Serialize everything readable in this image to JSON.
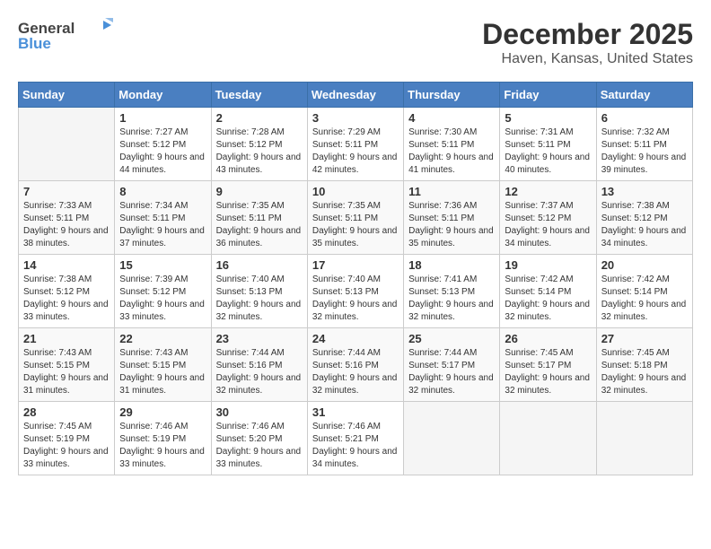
{
  "header": {
    "logo_general": "General",
    "logo_blue": "Blue",
    "title": "December 2025",
    "subtitle": "Haven, Kansas, United States"
  },
  "days_of_week": [
    "Sunday",
    "Monday",
    "Tuesday",
    "Wednesday",
    "Thursday",
    "Friday",
    "Saturday"
  ],
  "weeks": [
    [
      {
        "day": "",
        "sunrise": "",
        "sunset": "",
        "daylight": ""
      },
      {
        "day": "1",
        "sunrise": "Sunrise: 7:27 AM",
        "sunset": "Sunset: 5:12 PM",
        "daylight": "Daylight: 9 hours and 44 minutes."
      },
      {
        "day": "2",
        "sunrise": "Sunrise: 7:28 AM",
        "sunset": "Sunset: 5:12 PM",
        "daylight": "Daylight: 9 hours and 43 minutes."
      },
      {
        "day": "3",
        "sunrise": "Sunrise: 7:29 AM",
        "sunset": "Sunset: 5:11 PM",
        "daylight": "Daylight: 9 hours and 42 minutes."
      },
      {
        "day": "4",
        "sunrise": "Sunrise: 7:30 AM",
        "sunset": "Sunset: 5:11 PM",
        "daylight": "Daylight: 9 hours and 41 minutes."
      },
      {
        "day": "5",
        "sunrise": "Sunrise: 7:31 AM",
        "sunset": "Sunset: 5:11 PM",
        "daylight": "Daylight: 9 hours and 40 minutes."
      },
      {
        "day": "6",
        "sunrise": "Sunrise: 7:32 AM",
        "sunset": "Sunset: 5:11 PM",
        "daylight": "Daylight: 9 hours and 39 minutes."
      }
    ],
    [
      {
        "day": "7",
        "sunrise": "Sunrise: 7:33 AM",
        "sunset": "Sunset: 5:11 PM",
        "daylight": "Daylight: 9 hours and 38 minutes."
      },
      {
        "day": "8",
        "sunrise": "Sunrise: 7:34 AM",
        "sunset": "Sunset: 5:11 PM",
        "daylight": "Daylight: 9 hours and 37 minutes."
      },
      {
        "day": "9",
        "sunrise": "Sunrise: 7:35 AM",
        "sunset": "Sunset: 5:11 PM",
        "daylight": "Daylight: 9 hours and 36 minutes."
      },
      {
        "day": "10",
        "sunrise": "Sunrise: 7:35 AM",
        "sunset": "Sunset: 5:11 PM",
        "daylight": "Daylight: 9 hours and 35 minutes."
      },
      {
        "day": "11",
        "sunrise": "Sunrise: 7:36 AM",
        "sunset": "Sunset: 5:11 PM",
        "daylight": "Daylight: 9 hours and 35 minutes."
      },
      {
        "day": "12",
        "sunrise": "Sunrise: 7:37 AM",
        "sunset": "Sunset: 5:12 PM",
        "daylight": "Daylight: 9 hours and 34 minutes."
      },
      {
        "day": "13",
        "sunrise": "Sunrise: 7:38 AM",
        "sunset": "Sunset: 5:12 PM",
        "daylight": "Daylight: 9 hours and 34 minutes."
      }
    ],
    [
      {
        "day": "14",
        "sunrise": "Sunrise: 7:38 AM",
        "sunset": "Sunset: 5:12 PM",
        "daylight": "Daylight: 9 hours and 33 minutes."
      },
      {
        "day": "15",
        "sunrise": "Sunrise: 7:39 AM",
        "sunset": "Sunset: 5:12 PM",
        "daylight": "Daylight: 9 hours and 33 minutes."
      },
      {
        "day": "16",
        "sunrise": "Sunrise: 7:40 AM",
        "sunset": "Sunset: 5:13 PM",
        "daylight": "Daylight: 9 hours and 32 minutes."
      },
      {
        "day": "17",
        "sunrise": "Sunrise: 7:40 AM",
        "sunset": "Sunset: 5:13 PM",
        "daylight": "Daylight: 9 hours and 32 minutes."
      },
      {
        "day": "18",
        "sunrise": "Sunrise: 7:41 AM",
        "sunset": "Sunset: 5:13 PM",
        "daylight": "Daylight: 9 hours and 32 minutes."
      },
      {
        "day": "19",
        "sunrise": "Sunrise: 7:42 AM",
        "sunset": "Sunset: 5:14 PM",
        "daylight": "Daylight: 9 hours and 32 minutes."
      },
      {
        "day": "20",
        "sunrise": "Sunrise: 7:42 AM",
        "sunset": "Sunset: 5:14 PM",
        "daylight": "Daylight: 9 hours and 32 minutes."
      }
    ],
    [
      {
        "day": "21",
        "sunrise": "Sunrise: 7:43 AM",
        "sunset": "Sunset: 5:15 PM",
        "daylight": "Daylight: 9 hours and 31 minutes."
      },
      {
        "day": "22",
        "sunrise": "Sunrise: 7:43 AM",
        "sunset": "Sunset: 5:15 PM",
        "daylight": "Daylight: 9 hours and 31 minutes."
      },
      {
        "day": "23",
        "sunrise": "Sunrise: 7:44 AM",
        "sunset": "Sunset: 5:16 PM",
        "daylight": "Daylight: 9 hours and 32 minutes."
      },
      {
        "day": "24",
        "sunrise": "Sunrise: 7:44 AM",
        "sunset": "Sunset: 5:16 PM",
        "daylight": "Daylight: 9 hours and 32 minutes."
      },
      {
        "day": "25",
        "sunrise": "Sunrise: 7:44 AM",
        "sunset": "Sunset: 5:17 PM",
        "daylight": "Daylight: 9 hours and 32 minutes."
      },
      {
        "day": "26",
        "sunrise": "Sunrise: 7:45 AM",
        "sunset": "Sunset: 5:17 PM",
        "daylight": "Daylight: 9 hours and 32 minutes."
      },
      {
        "day": "27",
        "sunrise": "Sunrise: 7:45 AM",
        "sunset": "Sunset: 5:18 PM",
        "daylight": "Daylight: 9 hours and 32 minutes."
      }
    ],
    [
      {
        "day": "28",
        "sunrise": "Sunrise: 7:45 AM",
        "sunset": "Sunset: 5:19 PM",
        "daylight": "Daylight: 9 hours and 33 minutes."
      },
      {
        "day": "29",
        "sunrise": "Sunrise: 7:46 AM",
        "sunset": "Sunset: 5:19 PM",
        "daylight": "Daylight: 9 hours and 33 minutes."
      },
      {
        "day": "30",
        "sunrise": "Sunrise: 7:46 AM",
        "sunset": "Sunset: 5:20 PM",
        "daylight": "Daylight: 9 hours and 33 minutes."
      },
      {
        "day": "31",
        "sunrise": "Sunrise: 7:46 AM",
        "sunset": "Sunset: 5:21 PM",
        "daylight": "Daylight: 9 hours and 34 minutes."
      },
      {
        "day": "",
        "sunrise": "",
        "sunset": "",
        "daylight": ""
      },
      {
        "day": "",
        "sunrise": "",
        "sunset": "",
        "daylight": ""
      },
      {
        "day": "",
        "sunrise": "",
        "sunset": "",
        "daylight": ""
      }
    ]
  ]
}
